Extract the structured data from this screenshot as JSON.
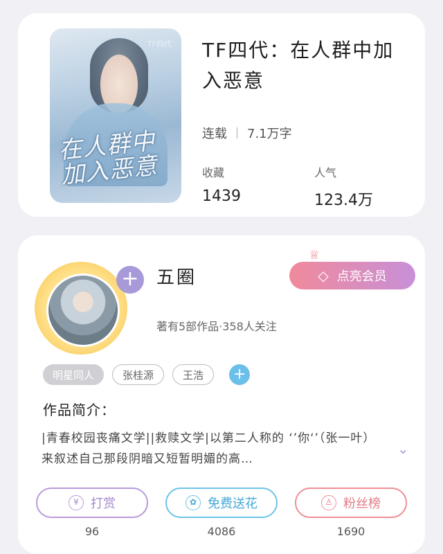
{
  "book": {
    "cover_title": "在人群中 加入恶意",
    "cover_mark": "TF四代",
    "title": "TF四代：在人群中加入恶意",
    "status": "连载",
    "word_count": "7.1万字",
    "favorites_label": "收藏",
    "favorites_value": "1439",
    "popularity_label": "人气",
    "popularity_value": "123.4万"
  },
  "author": {
    "name": "五圈",
    "subtitle": "著有5部作品·358人关注",
    "follow_icon": "+",
    "vip_label": "点亮会员",
    "vip_icon": "diamond-icon",
    "crown_icon": "crown-icon"
  },
  "tags": [
    "明星同人",
    "张桂源",
    "王浩"
  ],
  "tag_add": "+",
  "intro": {
    "heading": "作品简介：",
    "text": "|青春校园丧痛文学||救赎文学|以第二人称的 ‘’你‘’（张一叶）来叙述自己那段阴暗又短暂明媚的高…",
    "expand_icon": "chevron-down-icon"
  },
  "actions": [
    {
      "label": "打赏",
      "icon": "yen-icon",
      "count": "96",
      "color": "#b89ad8"
    },
    {
      "label": "免费送花",
      "icon": "flower-icon",
      "count": "4086",
      "color": "#6cc3e6"
    },
    {
      "label": "粉丝榜",
      "icon": "user-icon",
      "count": "1690",
      "color": "#ef8d95"
    }
  ],
  "colors": {
    "background": "#f1f0f4",
    "accent_purple": "#a89ad8",
    "vip_gradient_start": "#f08a9b",
    "vip_gradient_end": "#c890d8"
  }
}
